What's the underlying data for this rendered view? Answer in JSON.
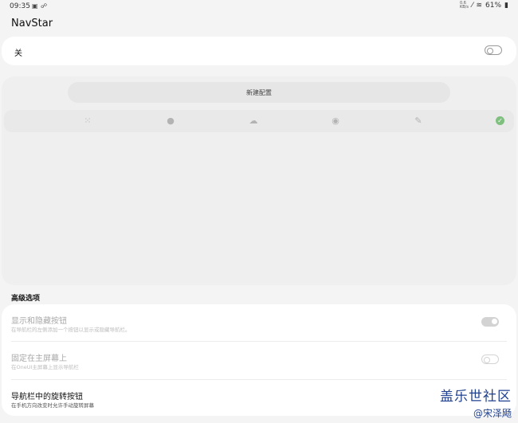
{
  "status_bar": {
    "time": "09:35",
    "left_icons": [
      "image-icon",
      "link-icon"
    ],
    "battery": "61%"
  },
  "app": {
    "title": "NavStar"
  },
  "master": {
    "label": "关",
    "enabled": false
  },
  "config": {
    "new_config_label": "新建配置",
    "styles": [
      "dots-style-icon",
      "blob-style-icon",
      "cloud-style-icon",
      "disc-style-icon",
      "sprinkle-style-icon"
    ],
    "selected_icon": "check-icon"
  },
  "advanced": {
    "section_title": "高级选项",
    "items": [
      {
        "title": "显示和隐藏按钮",
        "subtitle": "在导航栏的左侧添加一个按钮以显示或隐藏导航栏。",
        "enabled": false,
        "toggle_on": true
      },
      {
        "title": "固定在主屏幕上",
        "subtitle": "在OneUI主屏幕上显示导航栏",
        "enabled": false,
        "toggle_on": false
      },
      {
        "title": "导航栏中的旋转按钮",
        "subtitle": "在手机方向改变时允许手动旋转屏幕",
        "enabled": true,
        "toggle_on": false
      }
    ]
  },
  "watermark": {
    "line1": "盖乐世社区",
    "line2": "@宋泽飏"
  }
}
